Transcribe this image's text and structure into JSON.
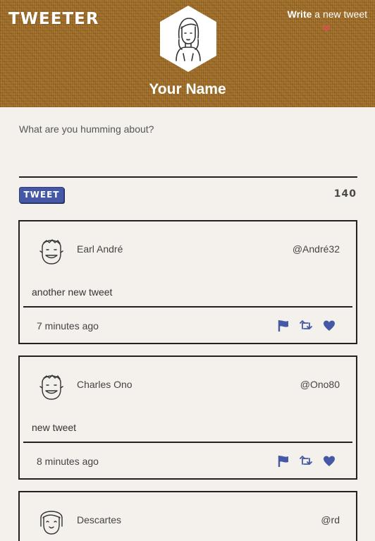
{
  "app": {
    "brand": "TWEETER",
    "write_bold": "Write",
    "write_rest": " a new tweet",
    "profile_name": "Your Name"
  },
  "compose": {
    "placeholder": "What are you humming about?",
    "tweet_button": "TWEET",
    "char_count": "140"
  },
  "colors": {
    "accent_blue": "#4458a6",
    "chevron_red": "#d9534f",
    "header_wood": "#a87328",
    "page_bg": "#f4f1ed"
  },
  "icons": [
    "flag-icon",
    "retweet-icon",
    "heart-icon",
    "chevron-down-icon"
  ],
  "tweets": [
    {
      "author": "Earl André",
      "handle": "@André32",
      "text": "another new tweet",
      "time": "7 minutes ago"
    },
    {
      "author": "Charles Ono",
      "handle": "@Ono80",
      "text": "new tweet",
      "time": "8 minutes ago"
    },
    {
      "author": "Descartes",
      "handle": "@rd",
      "text": "",
      "time": ""
    }
  ]
}
